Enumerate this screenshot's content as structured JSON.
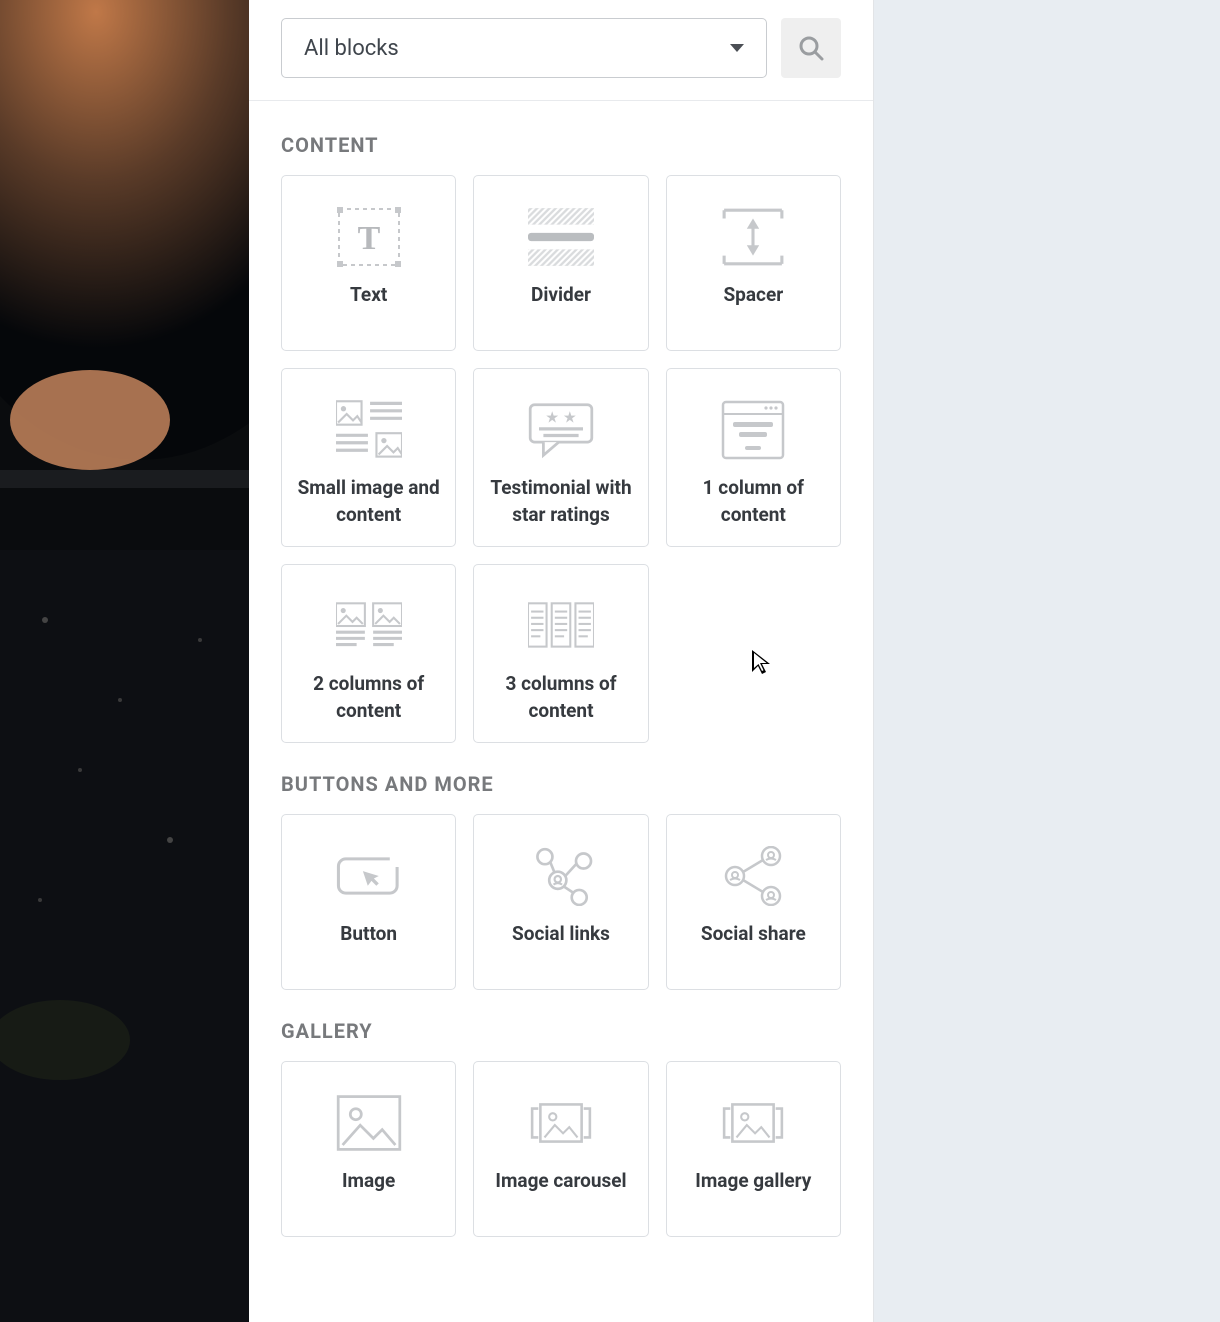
{
  "filter": {
    "selected": "All blocks"
  },
  "sections": [
    {
      "title": "CONTENT",
      "blocks": [
        {
          "label": "Text",
          "icon": "text"
        },
        {
          "label": "Divider",
          "icon": "divider"
        },
        {
          "label": "Spacer",
          "icon": "spacer"
        },
        {
          "label": "Small image and content",
          "icon": "small-image-content"
        },
        {
          "label": "Testimonial with star ratings",
          "icon": "testimonial"
        },
        {
          "label": "1 column of content",
          "icon": "col1"
        },
        {
          "label": "2 columns of content",
          "icon": "col2"
        },
        {
          "label": "3 columns of content",
          "icon": "col3"
        }
      ]
    },
    {
      "title": "BUTTONS AND MORE",
      "blocks": [
        {
          "label": "Button",
          "icon": "button"
        },
        {
          "label": "Social links",
          "icon": "social-links"
        },
        {
          "label": "Social share",
          "icon": "social-share"
        }
      ]
    },
    {
      "title": "GALLERY",
      "blocks": [
        {
          "label": "Image",
          "icon": "image"
        },
        {
          "label": "Image carousel",
          "icon": "carousel"
        },
        {
          "label": "Image gallery",
          "icon": "gallery"
        }
      ]
    }
  ]
}
